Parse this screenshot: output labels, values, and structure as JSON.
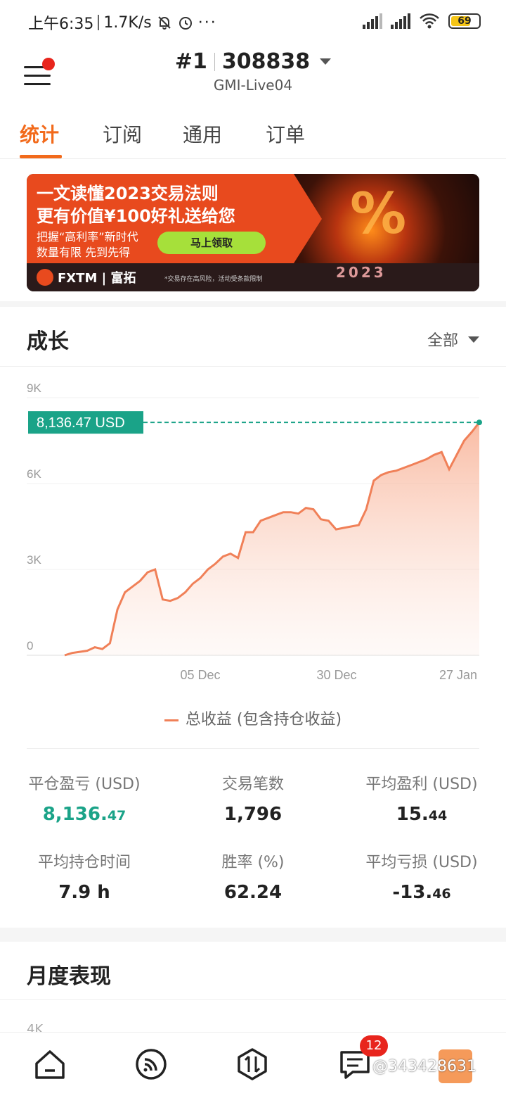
{
  "status_bar": {
    "time": "上午6:35",
    "speed": "1.7K/s",
    "battery": "69"
  },
  "header": {
    "rank": "#1",
    "account": "308838",
    "server": "GMI-Live04"
  },
  "tabs": [
    "统计",
    "订阅",
    "通用",
    "订单"
  ],
  "banner": {
    "title1": "一文读懂2023交易法则",
    "title2": "更有价值¥100好礼送给您",
    "sub1": "把握“高利率”新时代",
    "sub2": "数量有限 先到先得",
    "button": "马上领取",
    "logo": "FXTM | 富拓",
    "note": "*交易存在高风险，活动受条款限制",
    "percent": "%",
    "year": "2023"
  },
  "growth": {
    "title": "成长",
    "filter": "全部"
  },
  "chart_data": {
    "type": "area",
    "current_label": "8,136.47 USD",
    "y_ticks": [
      "9K",
      "6K",
      "3K",
      "0"
    ],
    "ylim": [
      0,
      9000
    ],
    "x_ticks": [
      "05 Dec",
      "30 Dec",
      "27 Jan"
    ],
    "grid": true,
    "series": [
      {
        "name": "总收益 (包含持仓收益)",
        "color": "#f08058",
        "values": [
          0,
          80,
          120,
          160,
          280,
          220,
          420,
          1600,
          2200,
          2400,
          2600,
          2900,
          3000,
          1950,
          1900,
          2000,
          2200,
          2500,
          2700,
          3000,
          3200,
          3450,
          3550,
          3400,
          4300,
          4300,
          4700,
          4800,
          4900,
          5000,
          5000,
          4950,
          5150,
          5100,
          4750,
          4700,
          4400,
          4450,
          4500,
          4550,
          5100,
          6100,
          6300,
          6400,
          6450,
          6550,
          6650,
          6750,
          6850,
          7000,
          7100,
          6500,
          7000,
          7500,
          7800,
          8136
        ]
      }
    ]
  },
  "legend": "总收益 (包含持仓收益)",
  "stats": [
    {
      "label": "平仓盈亏 (USD)",
      "int": "8,136.",
      "dec": "47",
      "green": true
    },
    {
      "label": "交易笔数",
      "int": "1,796",
      "dec": "",
      "green": false
    },
    {
      "label": "平均盈利 (USD)",
      "int": "15.",
      "dec": "44",
      "green": false
    },
    {
      "label": "平均持仓时间",
      "int": "7.9 h",
      "dec": "",
      "green": false
    },
    {
      "label": "胜率 (%)",
      "int": "62.24",
      "dec": "",
      "green": false
    },
    {
      "label": "平均亏损 (USD)",
      "int": "-13.",
      "dec": "46",
      "green": false
    }
  ],
  "monthly": {
    "title": "月度表现",
    "partial_tick": "4K"
  },
  "bottom_nav": {
    "badge": "12",
    "watermark": "@343428631"
  },
  "colors": {
    "accent": "#f26a1b",
    "green": "#1aa388",
    "line": "#f08058"
  }
}
